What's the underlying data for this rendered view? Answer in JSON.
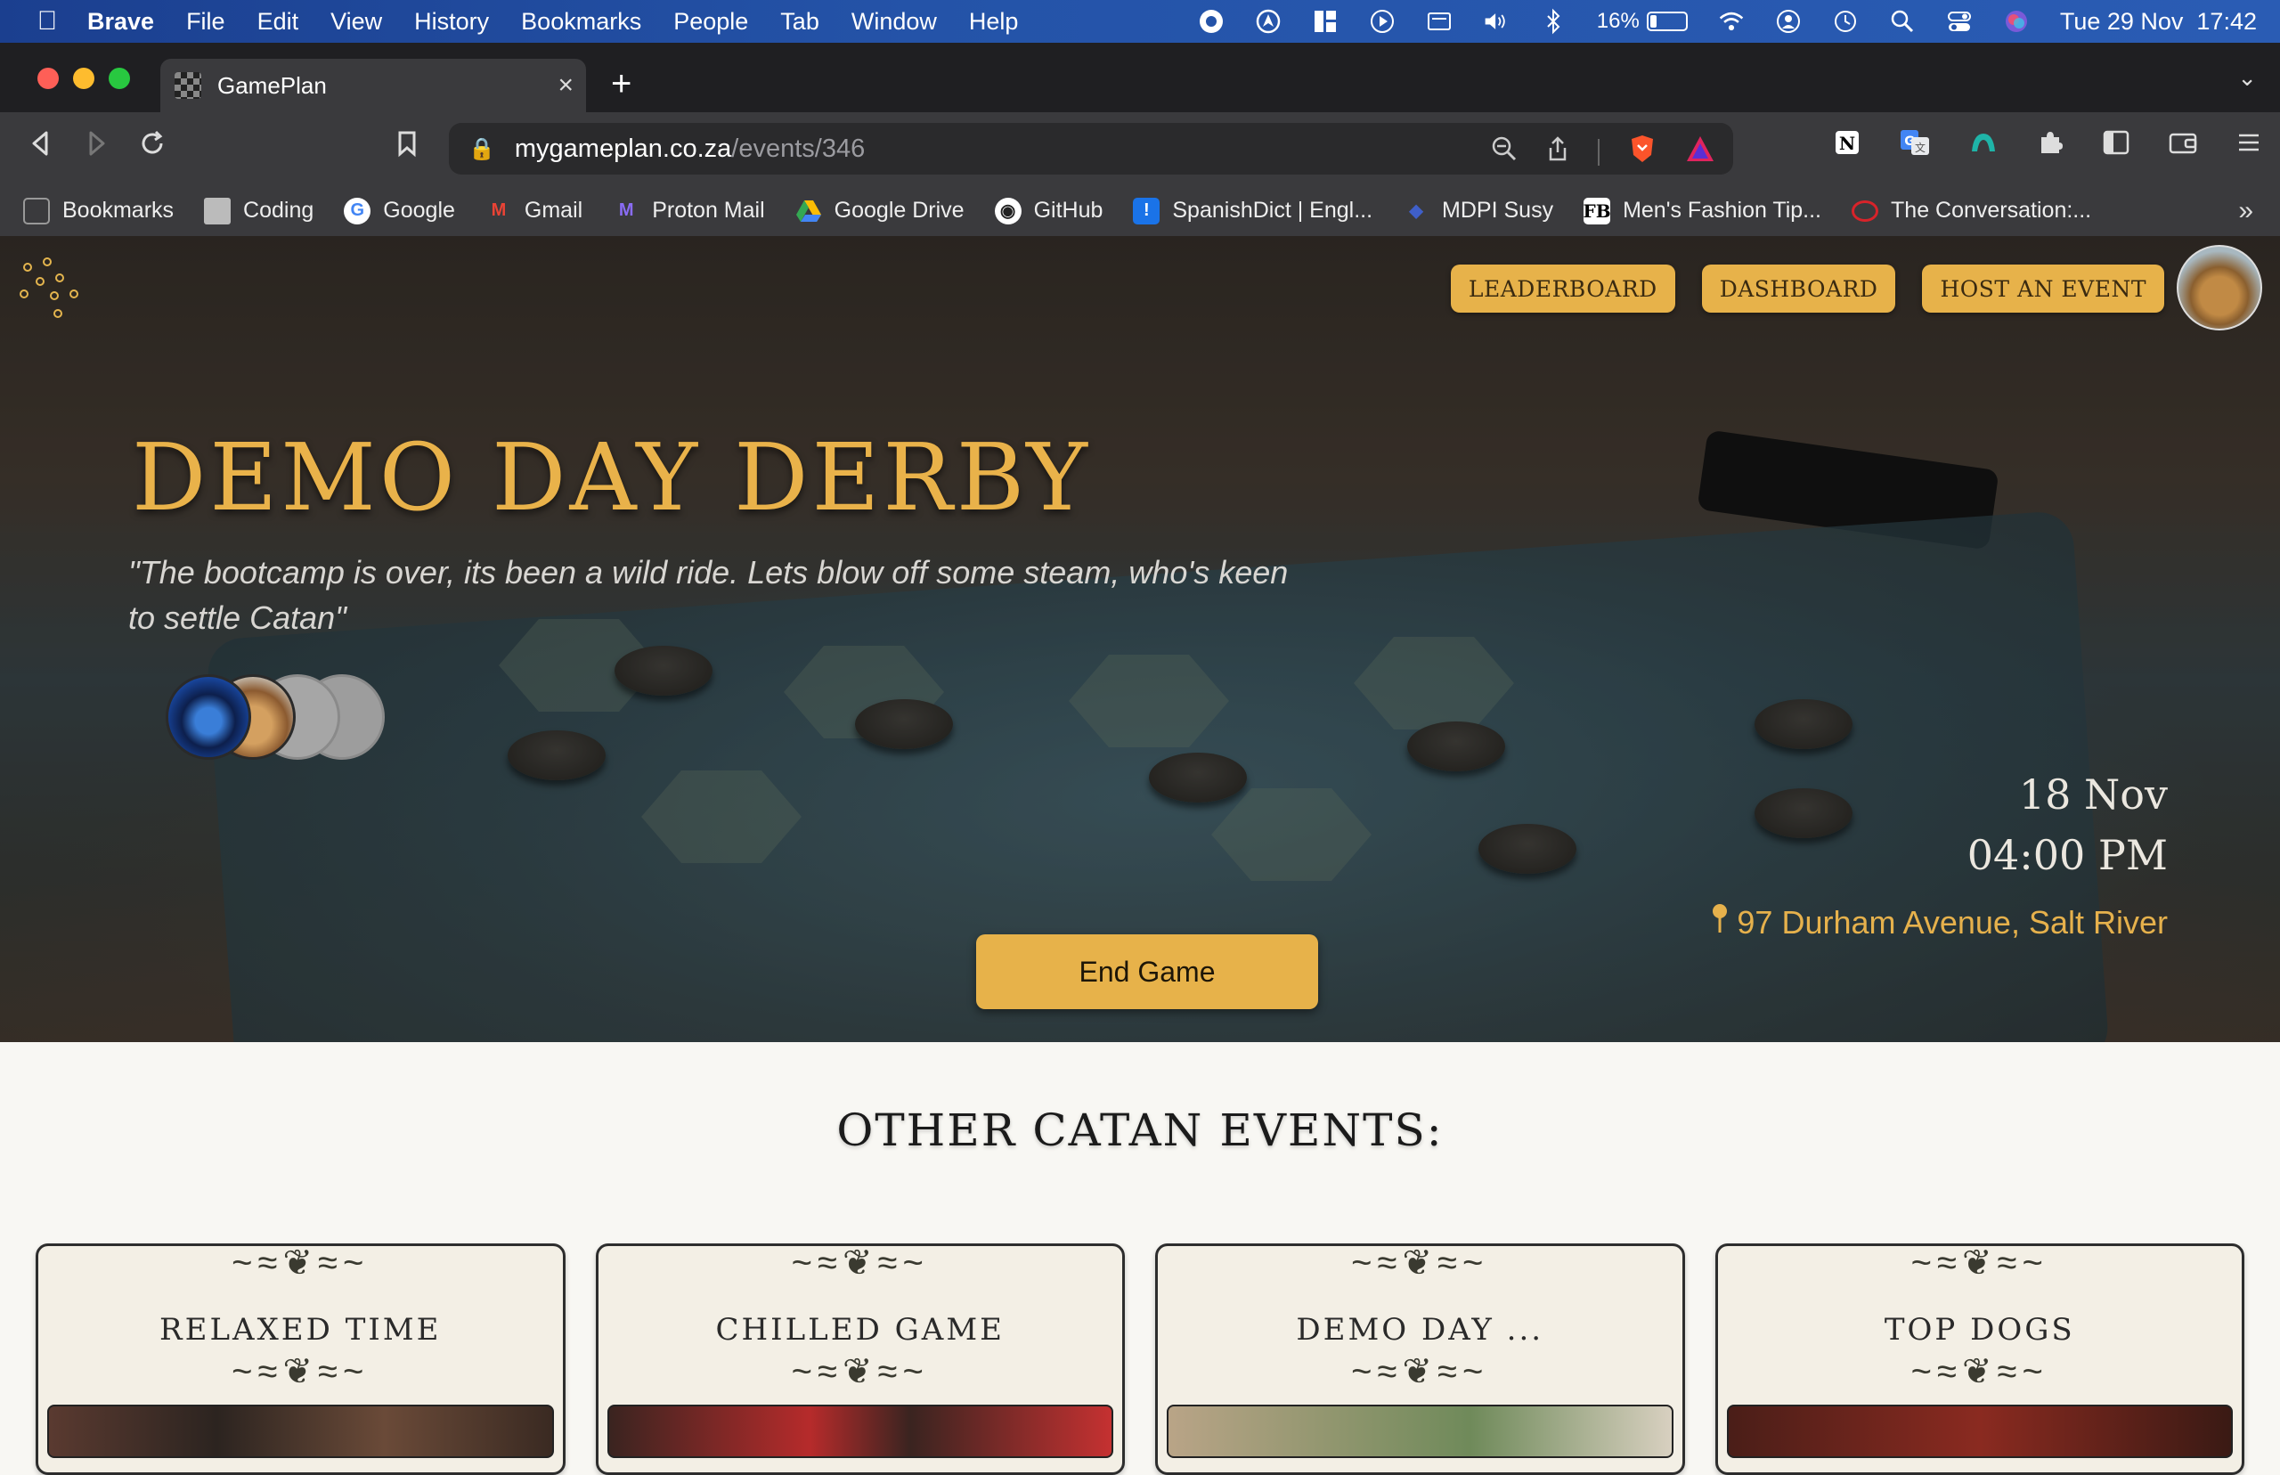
{
  "menubar": {
    "app": "Brave",
    "items": [
      "File",
      "Edit",
      "View",
      "History",
      "Bookmarks",
      "People",
      "Tab",
      "Window",
      "Help"
    ],
    "battery_percent": "16%",
    "datetime": "Tue 29 Nov  17:42"
  },
  "browser": {
    "tab_title": "GamePlan",
    "url_host": "mygameplan.co.za",
    "url_path": "/events/346",
    "bookmarks": [
      {
        "label": "Bookmarks",
        "icon": "bookmarks-icon"
      },
      {
        "label": "Coding",
        "icon": "folder-icon"
      },
      {
        "label": "Google",
        "icon": "google-icon"
      },
      {
        "label": "Gmail",
        "icon": "gmail-icon"
      },
      {
        "label": "Proton Mail",
        "icon": "proton-mail-icon"
      },
      {
        "label": "Google Drive",
        "icon": "google-drive-icon"
      },
      {
        "label": "GitHub",
        "icon": "github-icon"
      },
      {
        "label": "SpanishDict | Engl...",
        "icon": "spanishdict-icon"
      },
      {
        "label": "MDPI Susy",
        "icon": "mdpi-icon"
      },
      {
        "label": "Men's Fashion Tip...",
        "icon": "fb-icon"
      },
      {
        "label": "The Conversation:...",
        "icon": "conversation-icon"
      }
    ]
  },
  "nav": {
    "leaderboard": "LEADERBOARD",
    "dashboard": "DASHBOARD",
    "host_event": "HOST AN EVENT"
  },
  "event": {
    "title": "DEMO DAY DERBY",
    "quote": "\"The bootcamp is over, its been a wild ride. Lets blow off some steam, who's keen to settle Catan\"",
    "date": "18 Nov",
    "time": "04:00 PM",
    "location": "97 Durham Avenue, Salt River",
    "end_button": "End Game"
  },
  "other_events": {
    "heading": "OTHER CATAN EVENTS:",
    "cards": [
      "RELAXED TIME",
      "CHILLED GAME",
      "DEMO DAY ...",
      "TOP DOGS"
    ]
  },
  "colors": {
    "accent": "#e7b24a",
    "title": "#e9b24a",
    "page_bg": "#f8f7f3"
  }
}
